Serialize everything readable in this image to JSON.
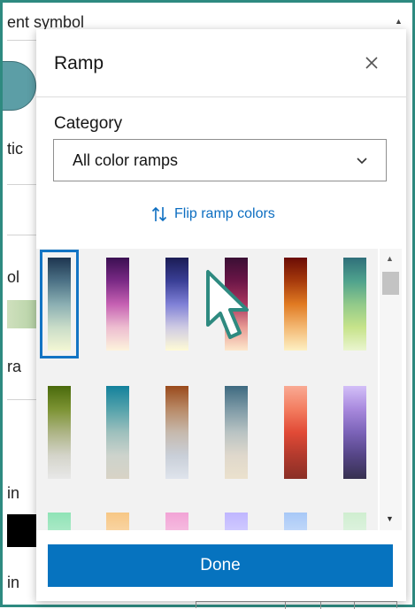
{
  "background_panel": {
    "title_fragment": "ent symbol",
    "text_fragments": [
      "tic",
      "ol",
      "ra",
      "in",
      "in"
    ]
  },
  "modal": {
    "title": "Ramp",
    "close_icon": "close-icon",
    "category_label": "Category",
    "category_value": "All color ramps",
    "category_icon": "chevron-down-icon",
    "flip_label": "Flip ramp colors",
    "flip_icon": "swap-vertical-icon",
    "done_label": "Done"
  },
  "ramps": {
    "selected_index": 0,
    "items": [
      {
        "name": "ramp-1",
        "colors": [
          "#1d3550",
          "#4c7185",
          "#8aaeb2",
          "#c9dcc8",
          "#f3f7d4"
        ]
      },
      {
        "name": "ramp-2",
        "colors": [
          "#3b0f52",
          "#7a2a85",
          "#c560b2",
          "#edbdd0",
          "#fdf3dc"
        ]
      },
      {
        "name": "ramp-3",
        "colors": [
          "#1b1c55",
          "#3a3f96",
          "#7f80d6",
          "#cfcbe3",
          "#fffbd6"
        ]
      },
      {
        "name": "ramp-4",
        "colors": [
          "#3a0f34",
          "#6b1647",
          "#a9365e",
          "#e89b95",
          "#fde8cc"
        ]
      },
      {
        "name": "ramp-5",
        "colors": [
          "#6b0c05",
          "#a63a0c",
          "#e07a22",
          "#f3b873",
          "#fdf0c3"
        ]
      },
      {
        "name": "ramp-6",
        "colors": [
          "#2f6f7a",
          "#4fa28d",
          "#91c98a",
          "#c6e38a",
          "#eaf5cf"
        ]
      },
      {
        "name": "ramp-7",
        "colors": [
          "#4a6a0c",
          "#7c9333",
          "#adb485",
          "#d4d4ca",
          "#e8e8e8"
        ]
      },
      {
        "name": "ramp-8",
        "colors": [
          "#13819c",
          "#54a2ab",
          "#9ec0bd",
          "#cdd3cc",
          "#d8d3c6"
        ]
      },
      {
        "name": "ramp-9",
        "colors": [
          "#9a4a1c",
          "#b88a67",
          "#c6b9ad",
          "#c9cfd8",
          "#dfe4ec"
        ]
      },
      {
        "name": "ramp-10",
        "colors": [
          "#3e6a80",
          "#7e9aa6",
          "#b9c3c3",
          "#dfd8cc",
          "#ebe1cd"
        ]
      },
      {
        "name": "ramp-11",
        "colors": [
          "#f9aa94",
          "#f37d60",
          "#e14a36",
          "#b23a2d",
          "#8a2f26"
        ]
      },
      {
        "name": "ramp-12",
        "colors": [
          "#d3bff8",
          "#a889dd",
          "#7b63b8",
          "#554586",
          "#373150"
        ]
      },
      {
        "name": "ramp-13",
        "colors": [
          "#8fe3b6",
          "#c4efd6"
        ]
      },
      {
        "name": "ramp-14",
        "colors": [
          "#f7c785",
          "#fbe0bd"
        ]
      },
      {
        "name": "ramp-15",
        "colors": [
          "#f2a3d6",
          "#f9d2e8"
        ]
      },
      {
        "name": "ramp-16",
        "colors": [
          "#bfb6ff",
          "#e0dcff"
        ]
      },
      {
        "name": "ramp-17",
        "colors": [
          "#a7c8f7",
          "#d8e6fb"
        ]
      },
      {
        "name": "ramp-18",
        "colors": [
          "#cfeed0",
          "#e9f6ea"
        ]
      }
    ]
  },
  "colors": {
    "frame": "#2e8a80",
    "accent": "#0673bf",
    "cursor_stroke": "#2e8a80"
  }
}
